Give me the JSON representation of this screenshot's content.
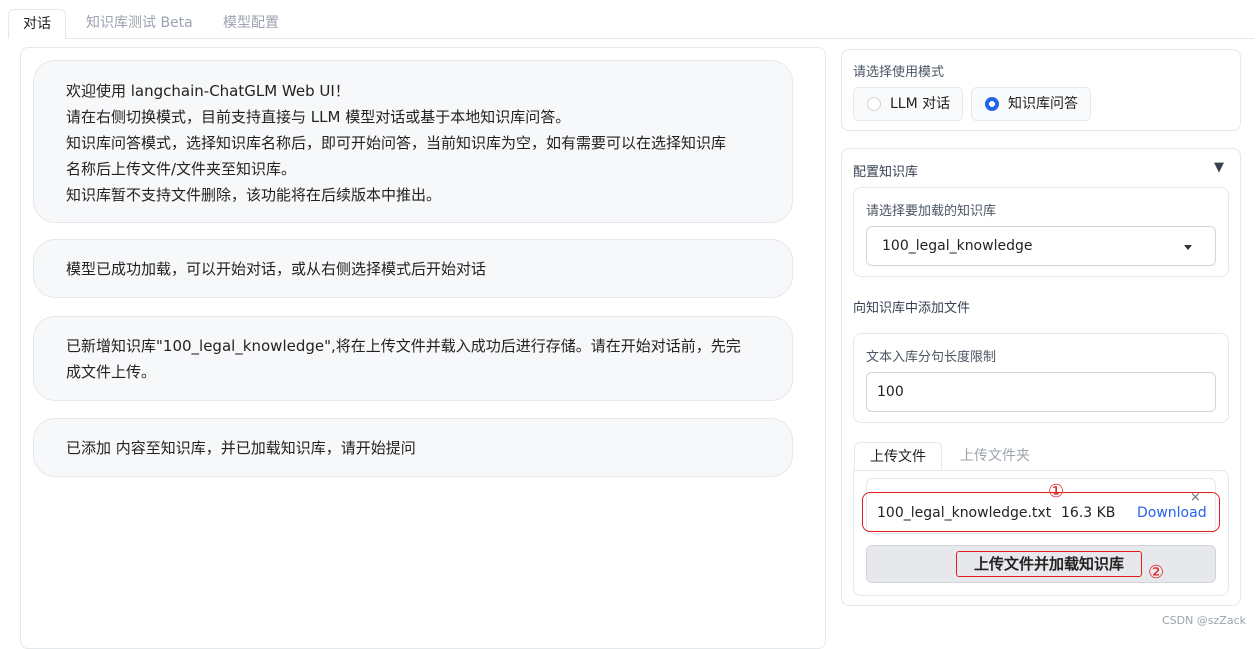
{
  "tabs": [
    {
      "label": "对话",
      "active": true
    },
    {
      "label": "知识库测试 Beta",
      "active": false
    },
    {
      "label": "模型配置",
      "active": false
    }
  ],
  "chat": {
    "messages": [
      {
        "lines": [
          "欢迎使用 langchain-ChatGLM Web UI！",
          "请在右侧切换模式，目前支持直接与 LLM 模型对话或基于本地知识库问答。",
          "知识库问答模式，选择知识库名称后，即可开始问答，当前知识库为空，如有需要可以在选择知识库",
          "名称后上传文件/文件夹至知识库。",
          "知识库暂不支持文件删除，该功能将在后续版本中推出。"
        ]
      },
      {
        "lines": [
          "模型已成功加载，可以开始对话，或从右侧选择模式后开始对话"
        ]
      },
      {
        "lines": [
          "已新增知识库\"100_legal_knowledge\",将在上传文件并载入成功后进行存储。请在开始对话前，先完",
          "成文件上传。"
        ]
      },
      {
        "lines": [
          "已添加 内容至知识库，并已加载知识库，请开始提问"
        ]
      }
    ]
  },
  "mode": {
    "label": "请选择使用模式",
    "options": [
      {
        "label": "LLM 对话",
        "selected": false
      },
      {
        "label": "知识库问答",
        "selected": true
      }
    ]
  },
  "kb": {
    "section_title": "配置知识库",
    "toggle_symbol": "▼",
    "select_label": "请选择要加载的知识库",
    "select_value": "100_legal_knowledge",
    "add_title": "向知识库中添加文件",
    "sentence_label": "文本入库分句长度限制",
    "sentence_value": "100",
    "upload_tabs": [
      {
        "label": "上传文件",
        "active": true
      },
      {
        "label": "上传文件夹",
        "active": false
      }
    ],
    "file": {
      "name": "100_legal_knowledge.txt",
      "size": "16.3 KB",
      "download": "Download",
      "close": "×"
    },
    "upload_button": "上传文件并加载知识库",
    "marker_1": "①",
    "marker_2": "②"
  },
  "watermark": "CSDN @szZack",
  "colors": {
    "accent": "#2563eb",
    "annotation": "#e11d1d",
    "link": "#2563eb"
  }
}
